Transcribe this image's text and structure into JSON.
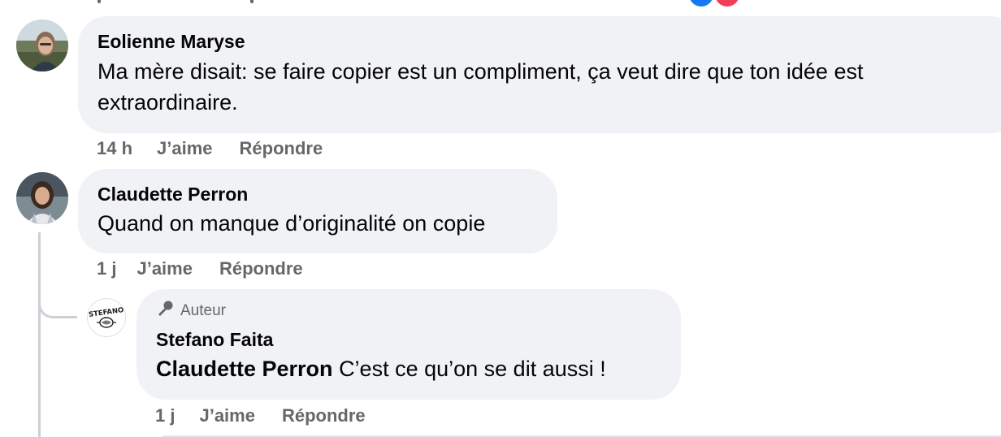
{
  "top_reactions": {
    "icons": [
      "like-reaction-icon",
      "love-reaction-icon"
    ],
    "colors": {
      "like": "#1877f2",
      "love": "#f33e58"
    }
  },
  "comments": [
    {
      "author": "Eolienne Maryse",
      "text": "Ma mère disait: se faire copier est un compliment, ça veut dire que ton idée est extraordinaire.",
      "time": "14 h",
      "like_label": "J’aime",
      "reply_label": "Répondre"
    },
    {
      "author": "Claudette Perron",
      "text": "Quand on manque d’originalité on copie",
      "time": "1 j",
      "like_label": "J’aime",
      "reply_label": "Répondre",
      "replies": [
        {
          "badge": "Auteur",
          "badge_icon": "microphone-icon",
          "author": "Stefano Faita",
          "mention": "Claudette Perron",
          "text": "C’est ce qu’on se dit aussi !",
          "time": "1 j",
          "like_label": "J’aime",
          "reply_label": "Répondre",
          "avatar_logo_text": "STEFANO"
        }
      ]
    }
  ],
  "colors": {
    "bubble": "#f0f2f5",
    "secondary_text": "#65676b",
    "thread_line": "#ccd0d5"
  }
}
